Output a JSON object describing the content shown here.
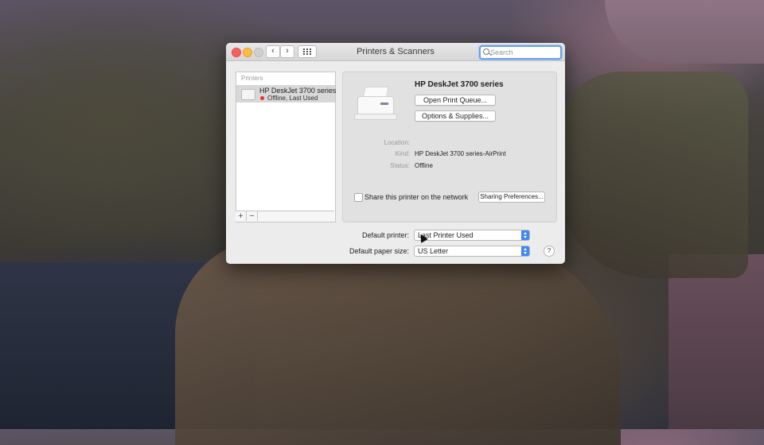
{
  "window": {
    "title": "Printers & Scanners"
  },
  "search": {
    "placeholder": "Search"
  },
  "printer_list": {
    "header": "Printers",
    "items": [
      {
        "name": "HP DeskJet 3700 series",
        "status": "Offline, Last Used",
        "status_color": "#e8322c"
      }
    ],
    "add_label": "+",
    "remove_label": "−"
  },
  "detail": {
    "printer_name": "HP DeskJet 3700 series",
    "open_queue_label": "Open Print Queue...",
    "options_label": "Options & Supplies...",
    "location_label": "Location:",
    "location_value": "",
    "kind_label": "Kind:",
    "kind_value": "HP DeskJet 3700 series-AirPrint",
    "status_label": "Status:",
    "status_value": "Offline",
    "share_label": "Share this printer on the network",
    "share_checked": false,
    "sharing_prefs_label": "Sharing Preferences..."
  },
  "defaults": {
    "default_printer_label": "Default printer:",
    "default_printer_value": "Last Printer Used",
    "default_paper_label": "Default paper size:",
    "default_paper_value": "US Letter"
  },
  "help_label": "?",
  "colors": {
    "accent": "#3f86f7",
    "close": "#fc605c",
    "minimize": "#fdbc40",
    "offline": "#e8322c"
  },
  "icons": [
    "chevron-left-icon",
    "chevron-right-icon",
    "grid-icon",
    "search-icon",
    "printer-icon",
    "help-icon"
  ]
}
